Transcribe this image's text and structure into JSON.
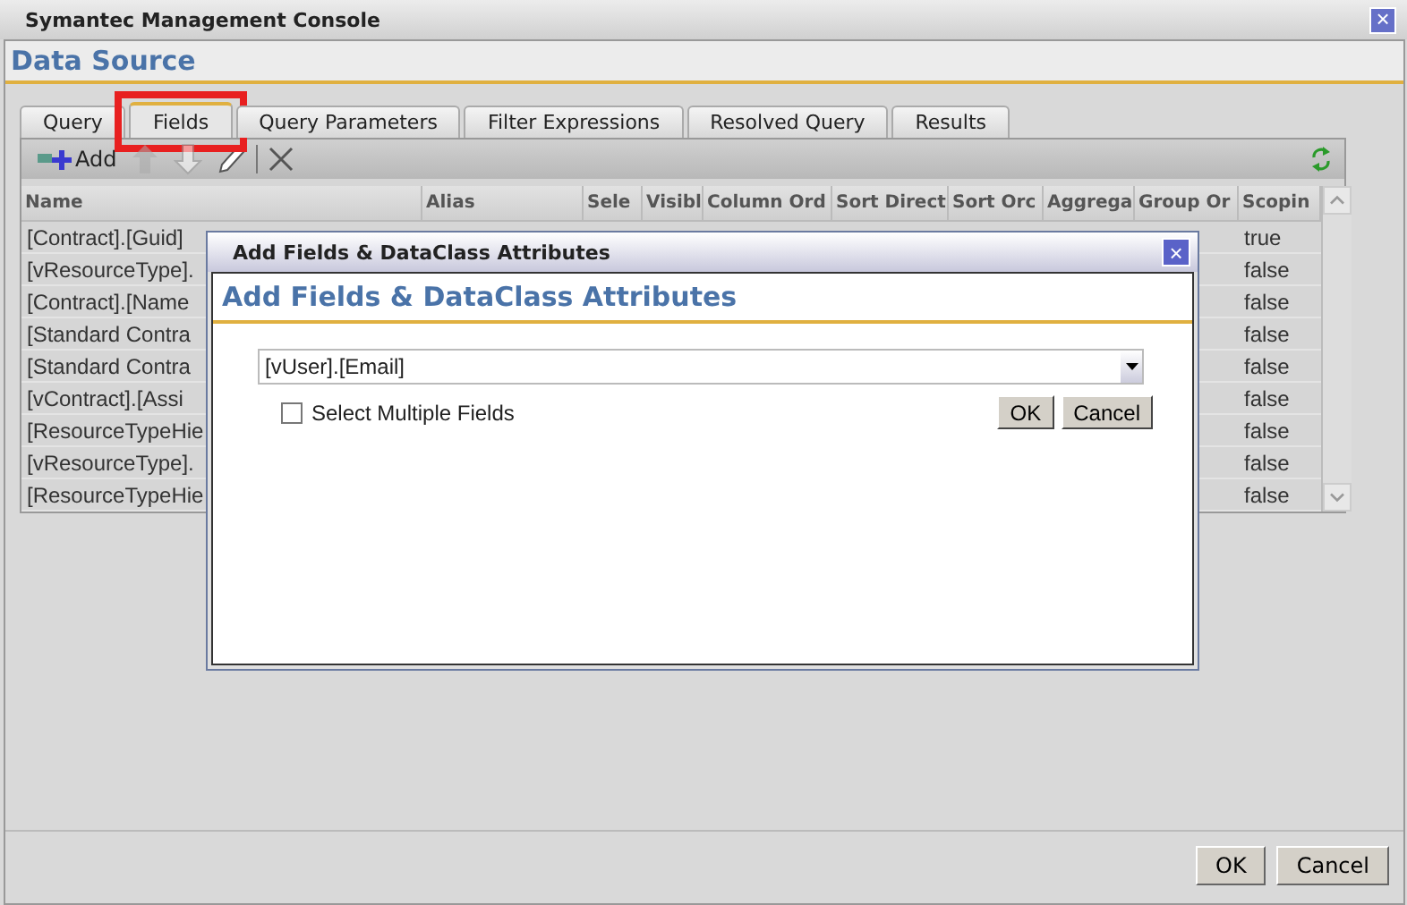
{
  "window": {
    "title": "Symantec Management Console",
    "close": "×"
  },
  "header": "Data Source",
  "tabs": [
    {
      "label": "Query",
      "selected": false,
      "highlighted": false
    },
    {
      "label": "Fields",
      "selected": true,
      "highlighted": true
    },
    {
      "label": "Query Parameters",
      "selected": false,
      "highlighted": false
    },
    {
      "label": "Filter Expressions",
      "selected": false,
      "highlighted": false
    },
    {
      "label": "Resolved Query",
      "selected": false,
      "highlighted": false
    },
    {
      "label": "Results",
      "selected": false,
      "highlighted": false
    }
  ],
  "toolbar": [
    {
      "kind": "add",
      "label": "Add",
      "disabled": false
    },
    {
      "kind": "up",
      "disabled": true
    },
    {
      "kind": "down",
      "disabled": true
    },
    {
      "kind": "edit",
      "disabled": false
    },
    {
      "kind": "delete",
      "disabled": false
    }
  ],
  "table": {
    "columns": [
      "Name",
      "Alias",
      "Sele",
      "Visibl",
      "Column Ord",
      "Sort Direct",
      "Sort Orc",
      "Aggrega",
      "Group Or",
      "Scopin"
    ],
    "rows": [
      {
        "name": "[Contract].[Guid]",
        "scoping": "true"
      },
      {
        "name": "[vResourceType].",
        "scoping": "false"
      },
      {
        "name": "[Contract].[Name",
        "scoping": "false"
      },
      {
        "name": "[Standard Contra",
        "scoping": "false"
      },
      {
        "name": "[Standard Contra",
        "scoping": "false"
      },
      {
        "name": "[vContract].[Assi",
        "scoping": "false"
      },
      {
        "name": "[ResourceTypeHie",
        "scoping": "false"
      },
      {
        "name": "[vResourceType].",
        "scoping": "false"
      },
      {
        "name": "[ResourceTypeHie",
        "scoping": "false"
      }
    ]
  },
  "dialog": {
    "title": "Add Fields & DataClass Attributes",
    "heading": "Add Fields & DataClass Attributes",
    "close": "×",
    "field_value": "[vUser].[Email]",
    "multiple": {
      "label": "Select Multiple Fields",
      "checked": false
    },
    "buttons": [
      "OK",
      "Cancel"
    ]
  },
  "buttons": [
    "OK",
    "Cancel"
  ]
}
